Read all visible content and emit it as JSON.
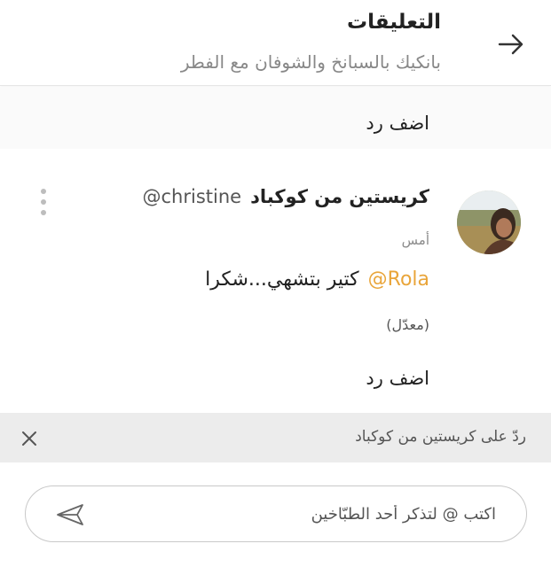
{
  "header": {
    "title": "التعليقات",
    "subtitle": "بانكيك بالسبانخ والشوفان مع الفطر",
    "back_icon": "arrow-right-icon"
  },
  "top_reply": {
    "label": "اضف رد"
  },
  "comment": {
    "author_name": "كريستين من كوكباد",
    "author_handle": "@christine",
    "time": "أمس",
    "mention": "@Rola",
    "text": "كتير بتشهي...شكرا",
    "edited": "(معدّل)",
    "add_reply": "اضف رد",
    "menu_icon": "more-vertical-icon",
    "mention_color": "#e9a53a"
  },
  "reply_bar": {
    "text": "ردّ على كريستين من كوكباد",
    "close_icon": "close-icon"
  },
  "composer": {
    "placeholder": "اكتب @ لتذكر أحد الطبّاخين",
    "send_icon": "send-icon"
  }
}
